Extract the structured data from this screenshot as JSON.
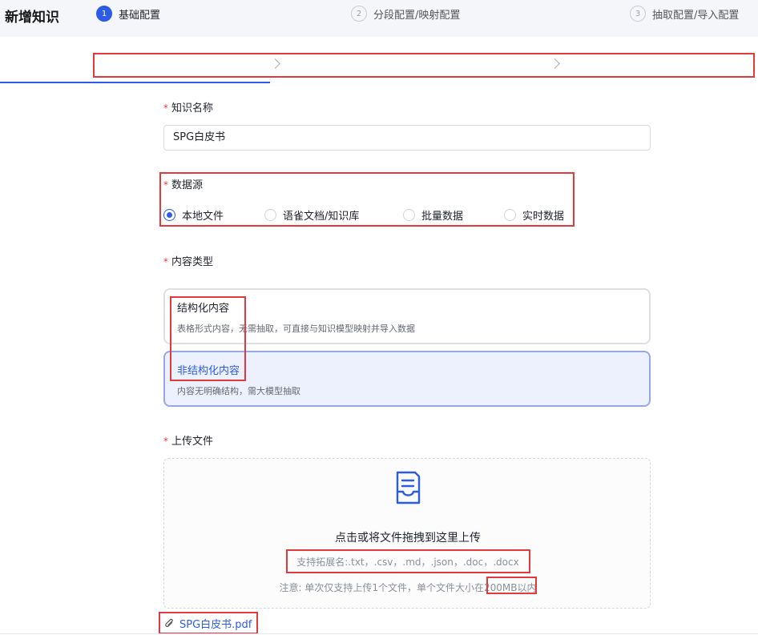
{
  "page": {
    "title": "新增知识"
  },
  "steps": [
    {
      "num": "1",
      "label": "基础配置",
      "state": "active"
    },
    {
      "num": "2",
      "label": "分段配置/映射配置",
      "state": "pending"
    },
    {
      "num": "3",
      "label": "抽取配置/导入配置",
      "state": "pending"
    }
  ],
  "form": {
    "name": {
      "label": "知识名称",
      "required_mark": "*",
      "value": "SPG白皮书"
    },
    "datasource": {
      "label": "数据源",
      "required_mark": "*",
      "options": [
        "本地文件",
        "语雀文档/知识库",
        "批量数据",
        "实时数据"
      ],
      "selected": "本地文件"
    },
    "content_type": {
      "label": "内容类型",
      "required_mark": "*",
      "cards": [
        {
          "title": "结构化内容",
          "desc": "表格形式内容，无需抽取，可直接与知识模型映射并导入数据"
        },
        {
          "title": "非结构化内容",
          "desc": "内容无明确结构，需大模型抽取"
        }
      ],
      "selected": "非结构化内容"
    },
    "upload": {
      "label": "上传文件",
      "required_mark": "*",
      "icon": "file-inbox-icon",
      "main_text": "点击或将文件拖拽到这里上传",
      "ext_text": "支持拓展名:.txt，.csv，.md，.json，.doc，.docx",
      "note_text": "注意: 单次仅支持上传1个文件，单个文件大小在200MB以内",
      "file_name": "SPG白皮书.pdf"
    }
  },
  "colors": {
    "primary": "#2c5ce6",
    "highlight": "#e0393e",
    "required": "#e0393e"
  }
}
